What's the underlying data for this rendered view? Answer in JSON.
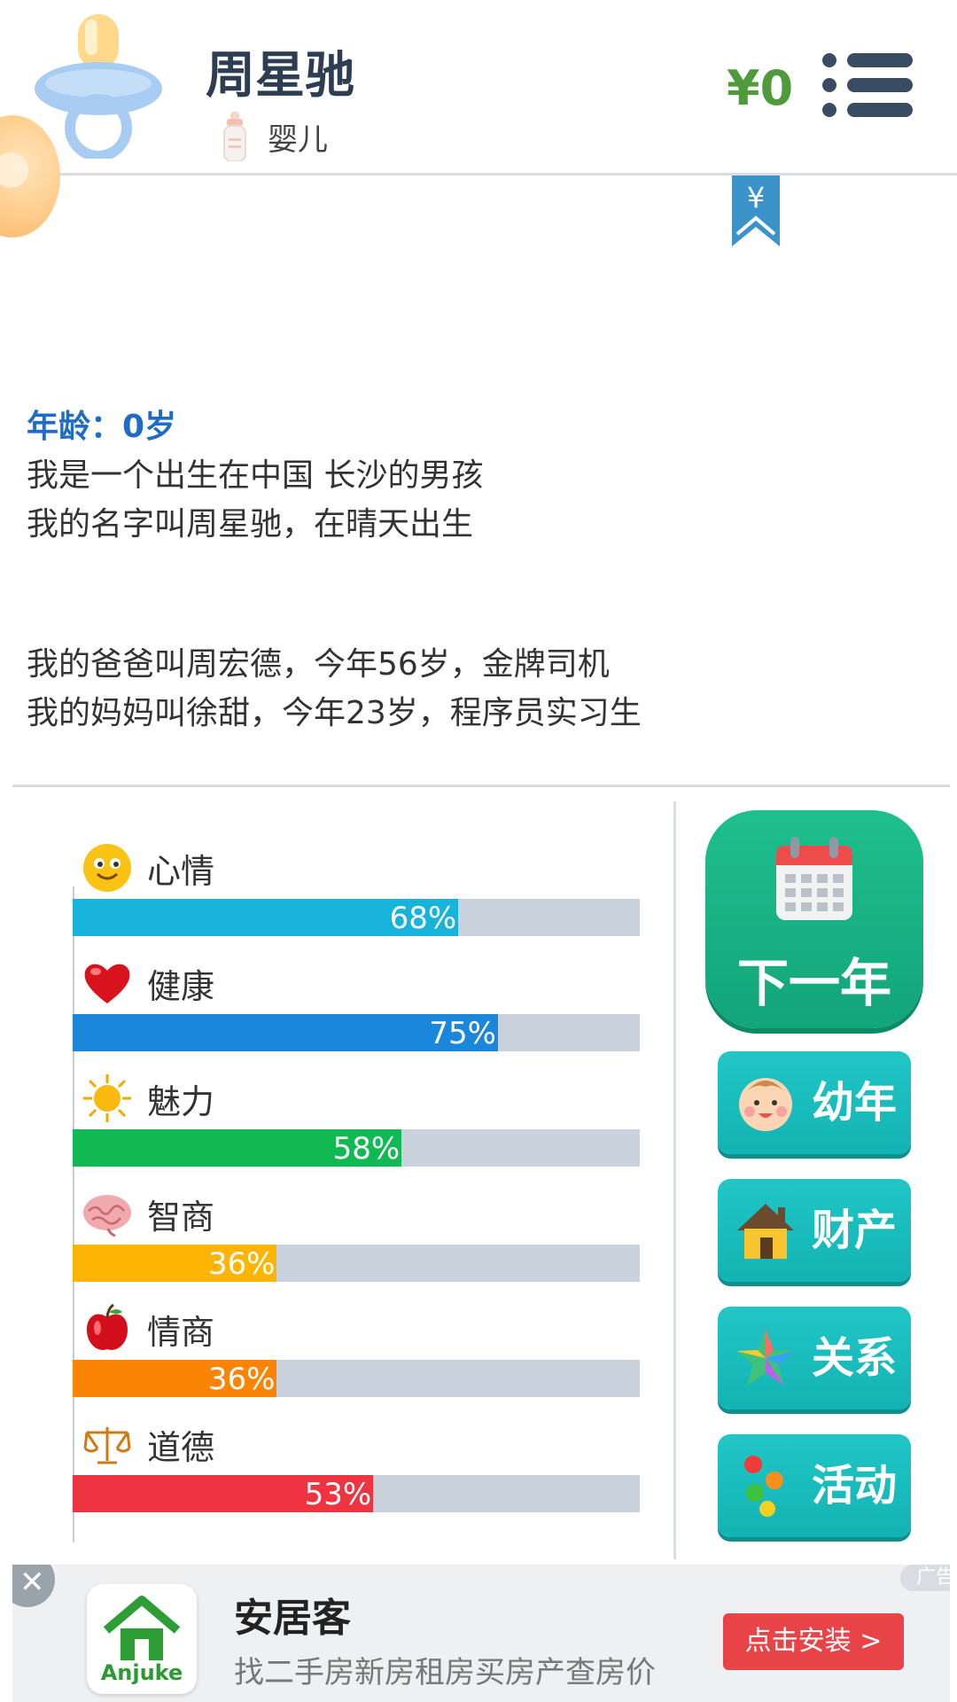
{
  "header": {
    "player_name": "周星驰",
    "life_stage": "婴儿",
    "money": "¥0"
  },
  "story": {
    "age": "年龄：0岁",
    "lines": [
      "我是一个出生在中国 长沙的男孩",
      "我的名字叫周星驰，在晴天出生"
    ],
    "parents": [
      "我的爸爸叫周宏德，今年56岁，金牌司机",
      "我的妈妈叫徐甜，今年23岁，程序员实习生"
    ]
  },
  "stats": [
    {
      "label": "心情",
      "percent": 68,
      "text": "68%",
      "color": "#17b3db",
      "icon": "smiley-icon"
    },
    {
      "label": "健康",
      "percent": 75,
      "text": "75%",
      "color": "#1a87dc",
      "icon": "heart-icon"
    },
    {
      "label": "魅力",
      "percent": 58,
      "text": "58%",
      "color": "#10b952",
      "icon": "sun-icon"
    },
    {
      "label": "智商",
      "percent": 36,
      "text": "36%",
      "color": "#fdb402",
      "icon": "brain-icon"
    },
    {
      "label": "情商",
      "percent": 36,
      "text": "36%",
      "color": "#fb8404",
      "icon": "apple-icon"
    },
    {
      "label": "道德",
      "percent": 53,
      "text": "53%",
      "color": "#ee3440",
      "icon": "scales-icon"
    }
  ],
  "actions": {
    "next_year": "下一年",
    "buttons": [
      {
        "label": "幼年",
        "icon": "baby-face-icon"
      },
      {
        "label": "财产",
        "icon": "house-icon"
      },
      {
        "label": "关系",
        "icon": "star-icon"
      },
      {
        "label": "活动",
        "icon": "activity-icon"
      }
    ]
  },
  "ad": {
    "close": "✕",
    "tag": "广告",
    "brand": "Anjuke",
    "title": "安居客",
    "description": "找二手房新房租房买房产查房价",
    "install": "点击安装 >"
  },
  "colors": {
    "header_text": "#2d3e52",
    "money": "#4f9a3a",
    "age_text": "#1f6cc5",
    "next_year_button": "#1fbf8e",
    "side_button": "#22c6c6",
    "bar_track": "#c9d2dc",
    "install_button": "#e84346"
  }
}
